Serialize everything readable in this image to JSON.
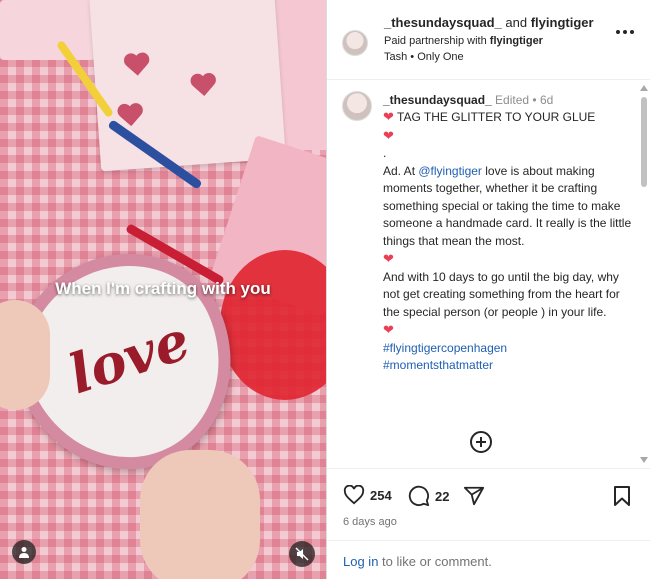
{
  "media": {
    "caption": "When I'm crafting with you",
    "plate_text": "love",
    "mute_icon": "speaker-muted-icon",
    "user_icon": "person-icon"
  },
  "header": {
    "author": "_thesundaysquad_",
    "and": "and",
    "coauthor": "flyingtiger",
    "partnership_prefix": "Paid partnership with",
    "partner": "flyingtiger",
    "audio": "Tash • Only One"
  },
  "caption": {
    "user": "_thesundaysquad_",
    "meta": "Edited • 6d",
    "line1_text": "TAG THE GLITTER TO YOUR GLUE",
    "dot": ".",
    "ad_prefix": "Ad. At",
    "ad_mention": "@flyingtiger",
    "ad_text": "love is about making moments together, whether it be crafting something special or taking the time to make someone a handmade card. It really is the little things that mean the most.",
    "para2": "And with 10 days to go until the big day, why not get creating something from the heart for the special person (or people ) in your life.",
    "hashtag1": "#flyingtigercopenhagen",
    "hashtag2": "#momentsthatmatter"
  },
  "actions": {
    "likes": "254",
    "comments": "22",
    "time": "6 days ago"
  },
  "login": {
    "link": "Log in",
    "text": " to like or comment."
  },
  "colors": {
    "heart": "#ea3f55",
    "link": "#1f5fb3"
  }
}
